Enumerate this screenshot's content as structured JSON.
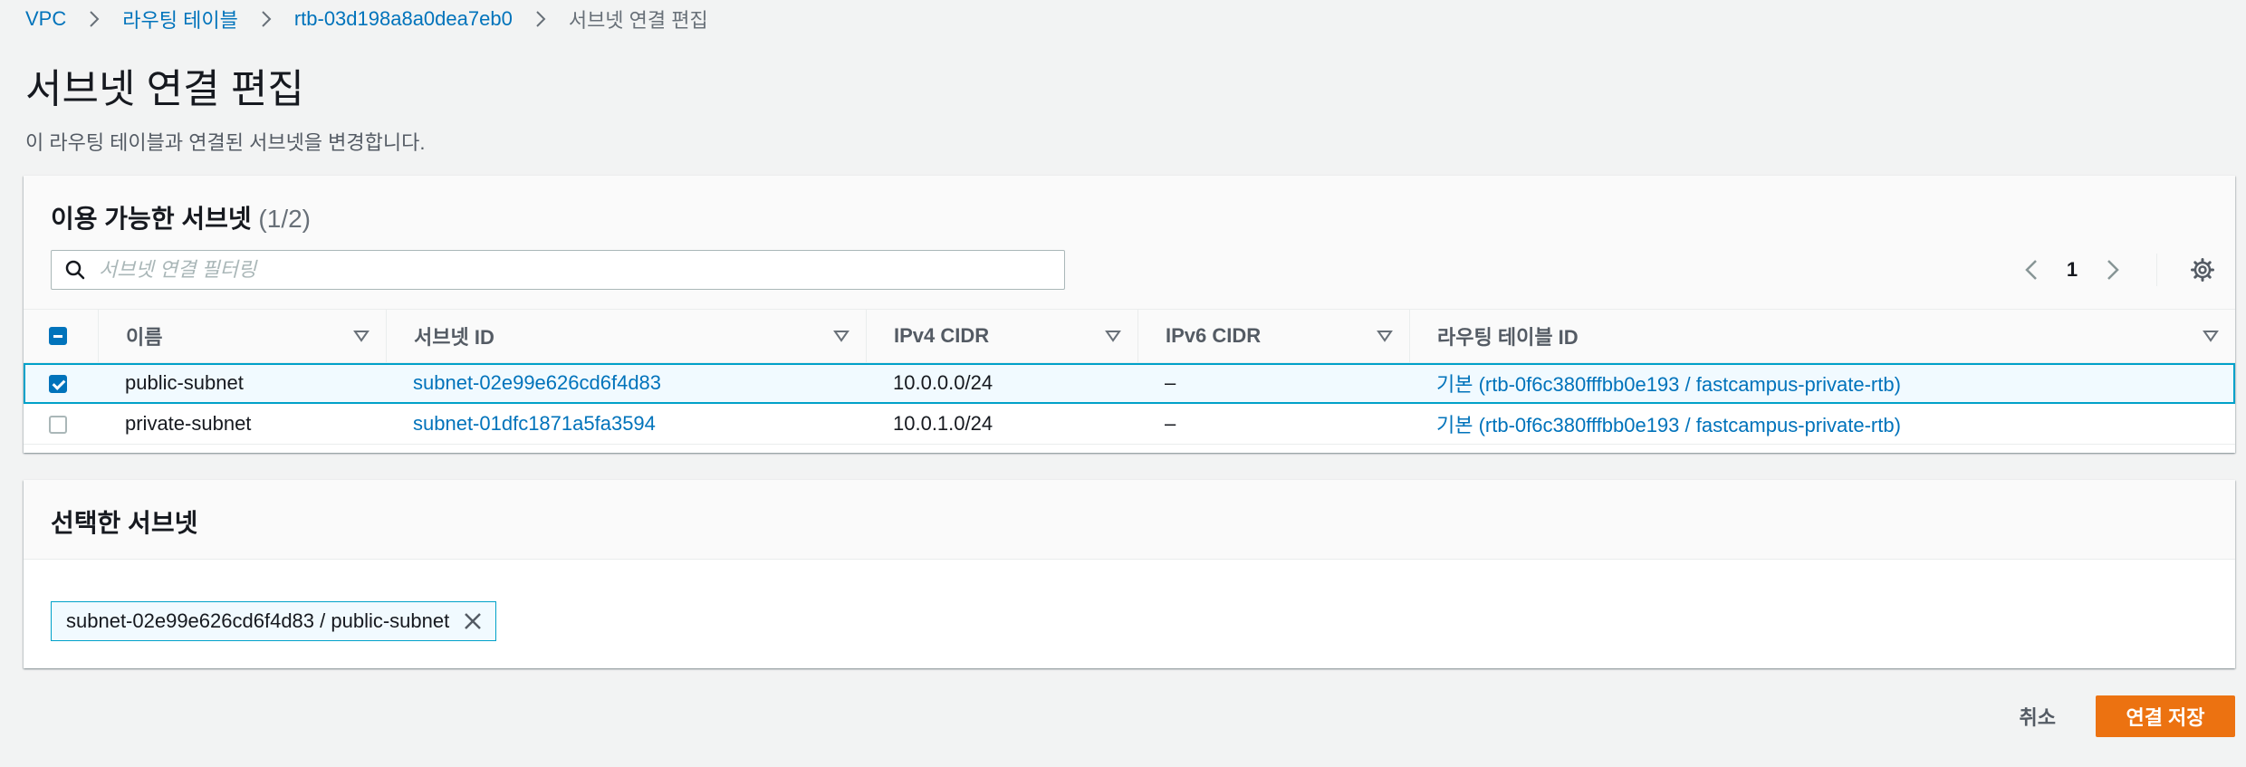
{
  "breadcrumb": {
    "items": [
      "VPC",
      "라우팅 테이블",
      "rtb-03d198a8a0dea7eb0"
    ],
    "current": "서브넷 연결 편집"
  },
  "page": {
    "title": "서브넷 연결 편집",
    "description": "이 라우팅 테이블과 연결된 서브넷을 변경합니다."
  },
  "available": {
    "title": "이용 가능한 서브넷",
    "count": "(1/2)",
    "filter_placeholder": "서브넷 연결 필터링",
    "page_number": "1",
    "columns": [
      "이름",
      "서브넷 ID",
      "IPv4 CIDR",
      "IPv6 CIDR",
      "라우팅 테이블 ID"
    ],
    "rows": [
      {
        "name": "public-subnet",
        "subnet_id": "subnet-02e99e626cd6f4d83",
        "ipv4": "10.0.0.0/24",
        "ipv6": "–",
        "route_table": "기본 (rtb-0f6c380fffbb0e193 / fastcampus-private-rtb)",
        "checked": true
      },
      {
        "name": "private-subnet",
        "subnet_id": "subnet-01dfc1871a5fa3594",
        "ipv4": "10.0.1.0/24",
        "ipv6": "–",
        "route_table": "기본 (rtb-0f6c380fffbb0e193 / fastcampus-private-rtb)",
        "checked": false
      }
    ]
  },
  "selected": {
    "title": "선택한 서브넷",
    "tokens": [
      "subnet-02e99e626cd6f4d83 / public-subnet"
    ]
  },
  "actions": {
    "cancel_label": "취소",
    "save_label": "연결 저장"
  },
  "colors": {
    "link": "#0073bb",
    "primary": "#ec7211",
    "selected_border": "#00a1c9"
  }
}
